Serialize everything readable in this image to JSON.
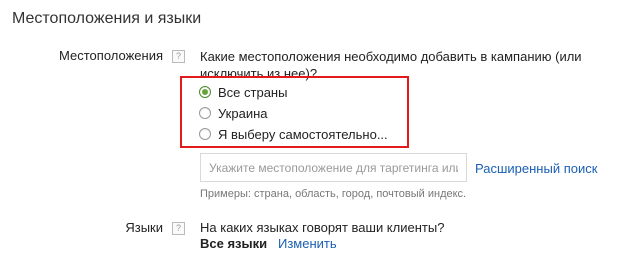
{
  "section": {
    "title": "Местоположения и языки"
  },
  "locations": {
    "label": "Местоположения",
    "help": "?",
    "question": "Какие местоположения необходимо добавить в кампанию (или исключить из нее)?",
    "options": [
      {
        "label": "Все страны",
        "selected": true
      },
      {
        "label": "Украина",
        "selected": false
      },
      {
        "label": "Я выберу самостоятельно...",
        "selected": false
      }
    ],
    "input_placeholder": "Укажите местоположение для таргетинга или исключения",
    "advanced_search_link": "Расширенный поиск",
    "examples_hint": "Примеры: страна, область, город, почтовый индекс."
  },
  "languages": {
    "label": "Языки",
    "help": "?",
    "question": "На каких языках говорят ваши клиенты?",
    "value": "Все языки",
    "change_link": "Изменить"
  },
  "colors": {
    "highlight_border": "#e21a1a",
    "link": "#1a5fb4",
    "radio_selected": "#67a33a"
  }
}
